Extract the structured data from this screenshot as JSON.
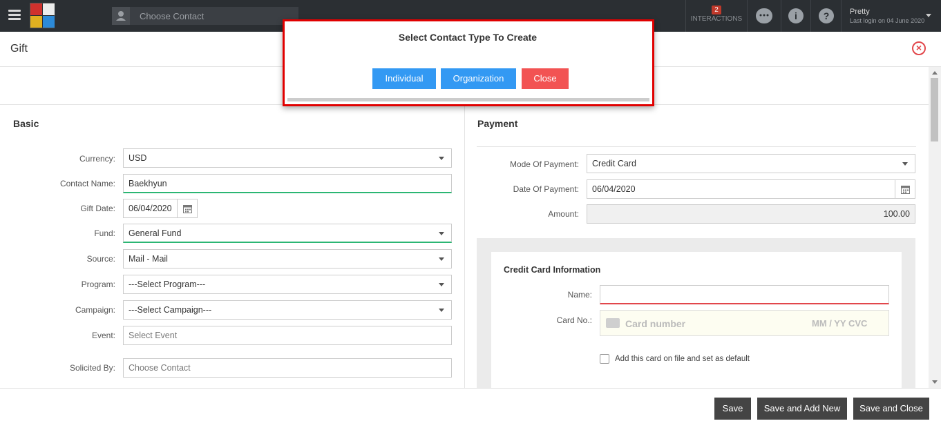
{
  "topbar": {
    "search_placeholder": "Choose Contact",
    "interactions_count": "2",
    "interactions_label": "INTERACTIONS",
    "user_name": "Pretty",
    "last_login": "Last login on 04 June 2020",
    "logo_colors": [
      "#d0312d",
      "#2c8ad8",
      "#e0b020",
      "#2c8ad8"
    ]
  },
  "gift": {
    "title": "Gift"
  },
  "basic": {
    "title": "Basic",
    "currency_label": "Currency:",
    "currency_value": "USD",
    "contact_label": "Contact Name:",
    "contact_value": "Baekhyun",
    "giftdate_label": "Gift Date:",
    "giftdate_value": "06/04/2020",
    "fund_label": "Fund:",
    "fund_value": "General Fund",
    "source_label": "Source:",
    "source_value": "Mail - Mail",
    "program_label": "Program:",
    "program_value": "---Select Program---",
    "campaign_label": "Campaign:",
    "campaign_value": "---Select Campaign---",
    "event_label": "Event:",
    "event_placeholder": "Select Event",
    "solicited_label": "Solicited By:",
    "solicited_placeholder": "Choose Contact"
  },
  "payment": {
    "title": "Payment",
    "mode_label": "Mode Of Payment:",
    "mode_value": "Credit Card",
    "date_label": "Date Of Payment:",
    "date_value": "06/04/2020",
    "amount_label": "Amount:",
    "amount_value": "100.00"
  },
  "credit_card": {
    "title": "Credit Card Information",
    "name_label": "Name:",
    "cardno_label": "Card No.:",
    "card_placeholder": "Card number",
    "mmyy_placeholder": "MM / YY  CVC",
    "save_card_label": "Add this card on file and set as default"
  },
  "footer": {
    "save": "Save",
    "save_add_new": "Save and Add New",
    "save_close": "Save and Close"
  },
  "popup": {
    "title": "Select Contact Type To Create",
    "individual": "Individual",
    "organization": "Organization",
    "close": "Close",
    "colors": {
      "primary": "#3399f3",
      "danger": "#f25353",
      "frame": "#e10000"
    }
  }
}
